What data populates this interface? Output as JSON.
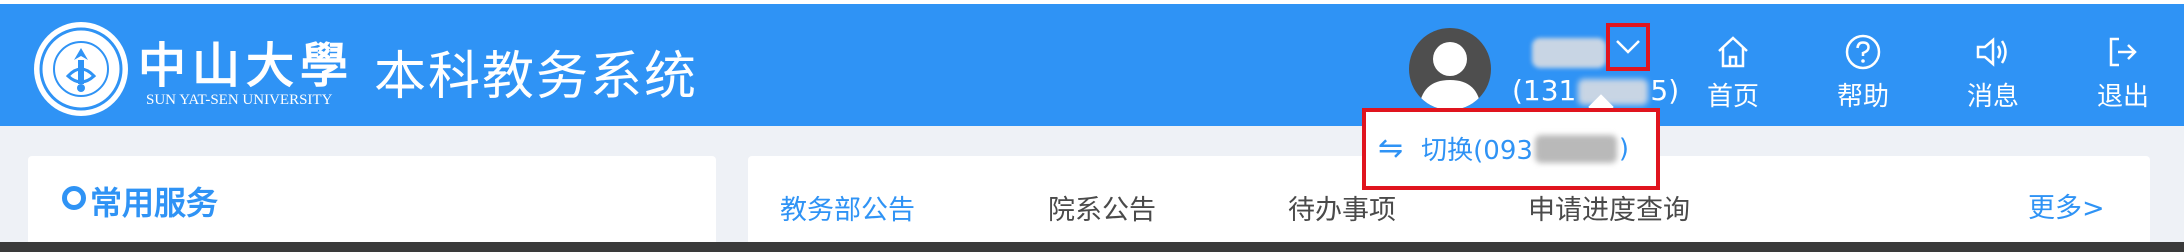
{
  "header": {
    "logo_cn": "中山大學",
    "logo_en": "SUN YAT-SEN UNIVERSITY",
    "system_title": "本科教务系统"
  },
  "user": {
    "id_prefix": "(131",
    "id_suffix": "5)"
  },
  "nav": [
    {
      "label": "首页",
      "icon": "home-icon"
    },
    {
      "label": "帮助",
      "icon": "help-icon"
    },
    {
      "label": "消息",
      "icon": "speaker-icon"
    },
    {
      "label": "退出",
      "icon": "logout-icon"
    }
  ],
  "dropdown": {
    "switch_prefix": "切换(093",
    "switch_suffix": ")"
  },
  "left_card": {
    "title": "常用服务"
  },
  "notice_tabs": [
    {
      "label": "教务部公告",
      "active": true
    },
    {
      "label": "院系公告",
      "active": false
    },
    {
      "label": "待办事项",
      "active": false
    },
    {
      "label": "申请进度查询",
      "active": false
    }
  ],
  "more_label": "更多>",
  "colors": {
    "primary": "#2f93f5",
    "highlight_border": "#e0141e",
    "header_bg": "#2f93f5",
    "content_bg": "#eef1f6"
  }
}
